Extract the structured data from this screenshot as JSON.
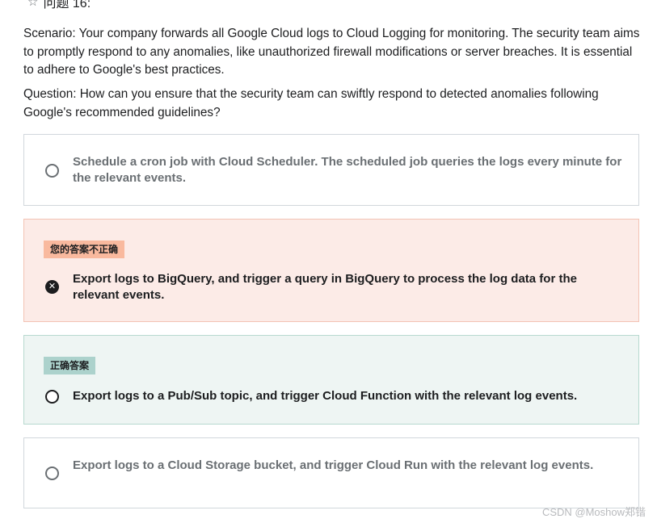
{
  "header": {
    "title": "问题 16:",
    "star_icon": "star-outline-icon"
  },
  "scenario": "Scenario: Your company forwards all Google Cloud logs to Cloud Logging for monitoring. The security team aims to promptly respond to any anomalies, like unauthorized firewall modifications or server breaches. It is essential to adhere to Google's best practices.",
  "question": "Question: How can you ensure that the security team can swiftly respond to detected anomalies following Google's recommended guidelines?",
  "options": [
    {
      "text": "Schedule a cron job with Cloud Scheduler. The scheduled job queries the logs every minute for the relevant events.",
      "state": "unselected"
    },
    {
      "badge": "您的答案不正确",
      "text": "Export logs to BigQuery, and trigger a query in BigQuery to process the log data for the relevant events.",
      "state": "selected-incorrect"
    },
    {
      "badge": "正确答案",
      "text": "Export logs to a Pub/Sub topic, and trigger Cloud Function with the relevant log events.",
      "state": "correct"
    },
    {
      "text": "Export logs to a Cloud Storage bucket, and trigger Cloud Run with the relevant log events.",
      "state": "unselected"
    }
  ],
  "watermark": "CSDN @Moshow郑锴",
  "colors": {
    "incorrect_bg": "#fcebe7",
    "incorrect_badge": "#f9b99e",
    "correct_bg": "#eef5f3",
    "correct_badge": "#acd2cc"
  }
}
